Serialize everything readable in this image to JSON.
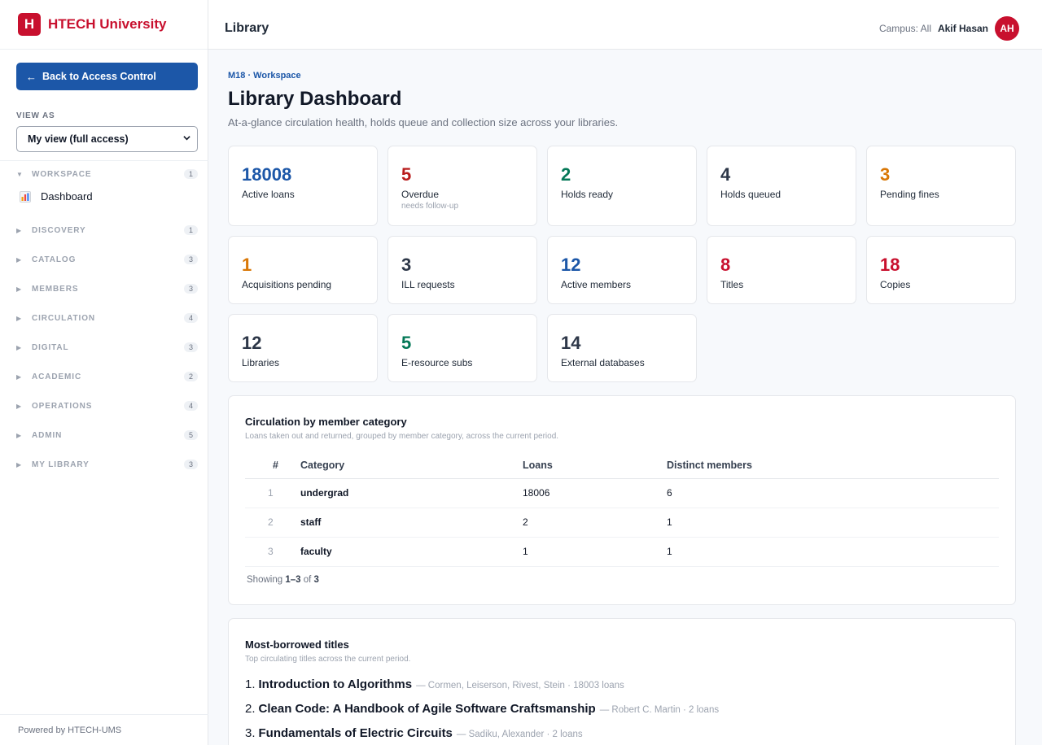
{
  "brand": {
    "logo_letter": "H",
    "name": "HTECH University"
  },
  "sidebar": {
    "back_label": "Back to Access Control",
    "back_arrow": "←",
    "view_as_label": "VIEW AS",
    "view_as_value": "My view (full access)",
    "groups": [
      {
        "name": "WORKSPACE",
        "count": "1",
        "expanded": true
      },
      {
        "name": "DISCOVERY",
        "count": "1"
      },
      {
        "name": "CATALOG",
        "count": "3"
      },
      {
        "name": "MEMBERS",
        "count": "3"
      },
      {
        "name": "CIRCULATION",
        "count": "4"
      },
      {
        "name": "DIGITAL",
        "count": "3"
      },
      {
        "name": "ACADEMIC",
        "count": "2"
      },
      {
        "name": "OPERATIONS",
        "count": "4"
      },
      {
        "name": "ADMIN",
        "count": "5"
      },
      {
        "name": "MY LIBRARY",
        "count": "3"
      }
    ],
    "workspace_item": "Dashboard",
    "powered_by": "Powered by HTECH-UMS"
  },
  "header": {
    "title": "Library",
    "campus": "Campus: All",
    "user_name": "Akif Hasan",
    "avatar_initials": "AH"
  },
  "page": {
    "breadcrumb": "M18 · Workspace",
    "title": "Library Dashboard",
    "subtitle": "At-a-glance circulation health, holds queue and collection size across your libraries."
  },
  "stats": [
    {
      "value": "18008",
      "label": "Active loans",
      "color": "#1c57a8"
    },
    {
      "value": "5",
      "label": "Overdue",
      "note": "needs follow-up",
      "color": "#b91c1c"
    },
    {
      "value": "2",
      "label": "Holds ready",
      "color": "#047857"
    },
    {
      "value": "4",
      "label": "Holds queued",
      "color": "#2d3748"
    },
    {
      "value": "3",
      "label": "Pending fines",
      "color": "#d97706"
    },
    {
      "value": "1",
      "label": "Acquisitions pending",
      "color": "#d97706"
    },
    {
      "value": "3",
      "label": "ILL requests",
      "color": "#2d3748"
    },
    {
      "value": "12",
      "label": "Active members",
      "color": "#1c57a8"
    },
    {
      "value": "8",
      "label": "Titles",
      "color": "#c8102e"
    },
    {
      "value": "18",
      "label": "Copies",
      "color": "#c8102e"
    },
    {
      "value": "12",
      "label": "Libraries",
      "color": "#2d3748"
    },
    {
      "value": "5",
      "label": "E-resource subs",
      "color": "#047857"
    },
    {
      "value": "14",
      "label": "External databases",
      "color": "#2d3748"
    }
  ],
  "circulation": {
    "title": "Circulation by member category",
    "subtitle": "Loans taken out and returned, grouped by member category, across the current period.",
    "columns": [
      "#",
      "Category",
      "Loans",
      "Distinct members"
    ],
    "rows": [
      {
        "n": "1",
        "category": "undergrad",
        "loans": "18006",
        "members": "6"
      },
      {
        "n": "2",
        "category": "staff",
        "loans": "2",
        "members": "1"
      },
      {
        "n": "3",
        "category": "faculty",
        "loans": "1",
        "members": "1"
      }
    ],
    "showing_prefix": "Showing",
    "showing_range": "1–3",
    "showing_of": "of",
    "showing_total": "3"
  },
  "most_borrowed": {
    "title": "Most-borrowed titles",
    "subtitle": "Top circulating titles across the current period.",
    "items": [
      {
        "n": "1.",
        "title": "Introduction to Algorithms",
        "meta": "— Cormen, Leiserson, Rivest, Stein · 18003 loans"
      },
      {
        "n": "2.",
        "title": "Clean Code: A Handbook of Agile Software Craftsmanship",
        "meta": "— Robert C. Martin · 2 loans"
      },
      {
        "n": "3.",
        "title": "Fundamentals of Electric Circuits",
        "meta": "— Sadiku, Alexander · 2 loans"
      }
    ]
  }
}
